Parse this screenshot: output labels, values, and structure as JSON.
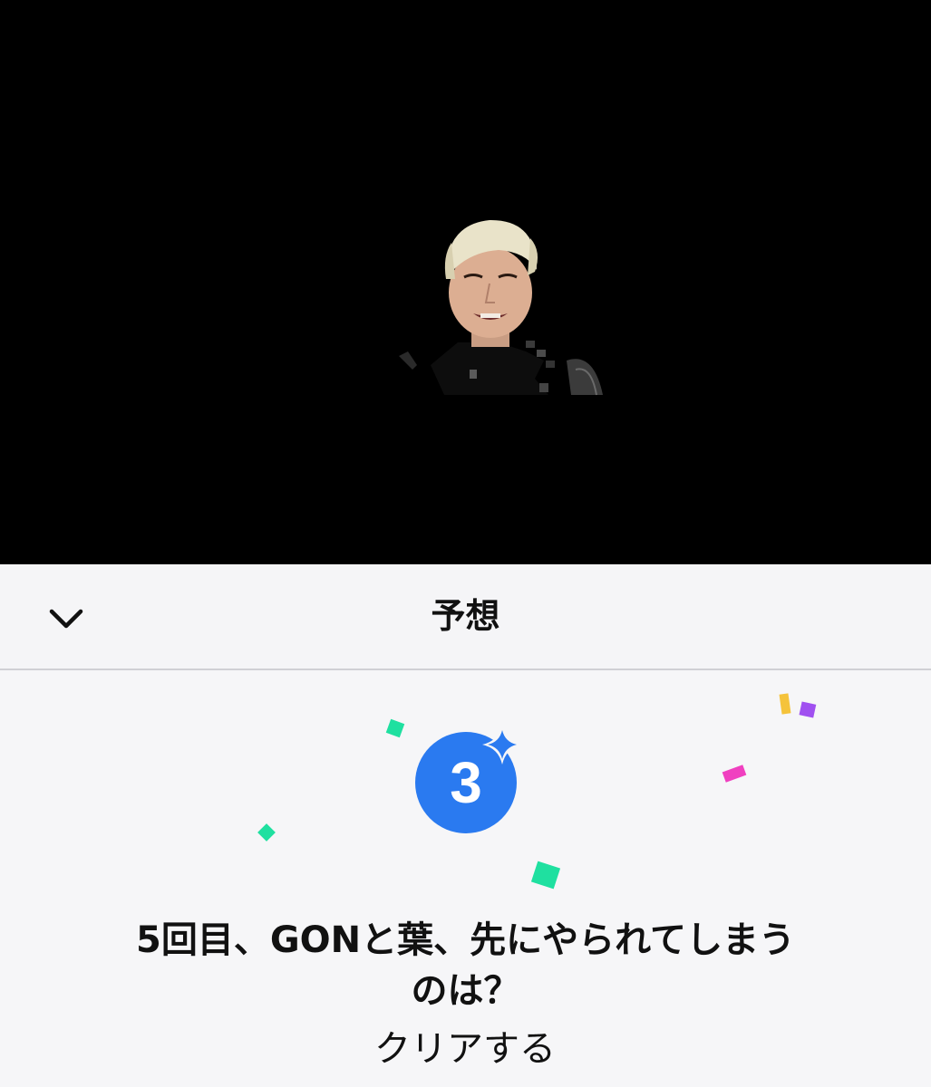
{
  "video": {
    "background_color": "#000000"
  },
  "header": {
    "title": "予想",
    "collapse_icon": "chevron-down-icon"
  },
  "prediction": {
    "badge_number": "3",
    "badge_color": "#2a7af0",
    "question": "5回目、GONと葉、先にやられてしまうのは？",
    "clear_label": "クリアする"
  },
  "confetti_colors": {
    "green": "#1fe0a0",
    "yellow": "#f5c33b",
    "purple": "#a050f0",
    "pink": "#f040c0"
  }
}
